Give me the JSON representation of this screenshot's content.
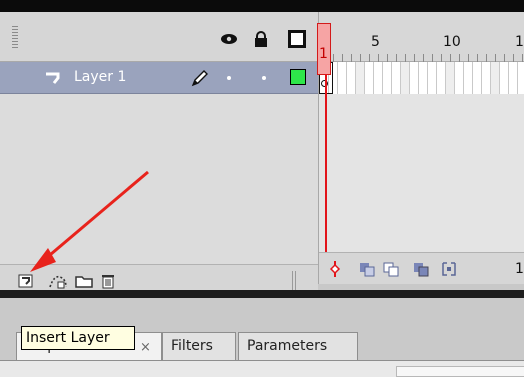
{
  "layers_panel": {
    "layer": {
      "name": "Layer 1",
      "color": "#2ee64a"
    },
    "header_icons": [
      "eye-icon",
      "lock-icon",
      "outline-icon"
    ],
    "footer_icons": [
      "insert-layer-icon",
      "add-motion-guide-icon",
      "insert-folder-icon",
      "delete-layer-icon"
    ]
  },
  "timeline": {
    "ruler_numbers": [
      "5",
      "10",
      "1"
    ],
    "playhead_frame": "1",
    "footer_frame": "1",
    "playhead_color": "#e2141a"
  },
  "tooltip": {
    "text": "Insert Layer"
  },
  "tabs": [
    {
      "label": "Properties"
    },
    {
      "label": "Filters"
    },
    {
      "label": "Parameters"
    }
  ],
  "tab_close_glyph": "×",
  "arrow_color": "#e8231c"
}
